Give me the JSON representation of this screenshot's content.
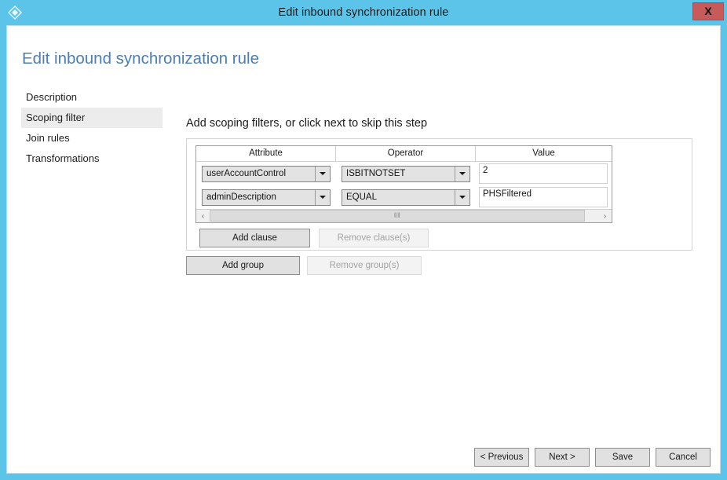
{
  "window": {
    "title": "Edit inbound synchronization rule",
    "icon": "azure-diamond-icon",
    "close_label": "X",
    "accent_color": "#5bc4e8",
    "close_color": "#c75b5b"
  },
  "page": {
    "heading": "Edit inbound synchronization rule",
    "heading_color": "#4a7eb5"
  },
  "sidebar": {
    "items": [
      {
        "label": "Description",
        "selected": false
      },
      {
        "label": "Scoping filter",
        "selected": true
      },
      {
        "label": "Join rules",
        "selected": false
      },
      {
        "label": "Transformations",
        "selected": false
      }
    ]
  },
  "main": {
    "heading": "Add scoping filters, or click next to skip this step",
    "grid": {
      "columns": [
        "Attribute",
        "Operator",
        "Value"
      ],
      "rows": [
        {
          "attribute": "userAccountControl",
          "operator": "ISBITNOTSET",
          "value": "2"
        },
        {
          "attribute": "adminDescription",
          "operator": "EQUAL",
          "value": "PHSFiltered"
        }
      ],
      "scrollbar": {
        "left_arrow": "‹",
        "right_arrow": "›",
        "grip": "‖‖"
      }
    },
    "clause_buttons": {
      "add": {
        "label": "Add clause",
        "enabled": true
      },
      "remove": {
        "label": "Remove clause(s)",
        "enabled": false
      }
    },
    "group_buttons": {
      "add": {
        "label": "Add group",
        "enabled": true
      },
      "remove": {
        "label": "Remove group(s)",
        "enabled": false
      }
    }
  },
  "footer": {
    "previous": "< Previous",
    "next": "Next >",
    "save": "Save",
    "cancel": "Cancel"
  }
}
